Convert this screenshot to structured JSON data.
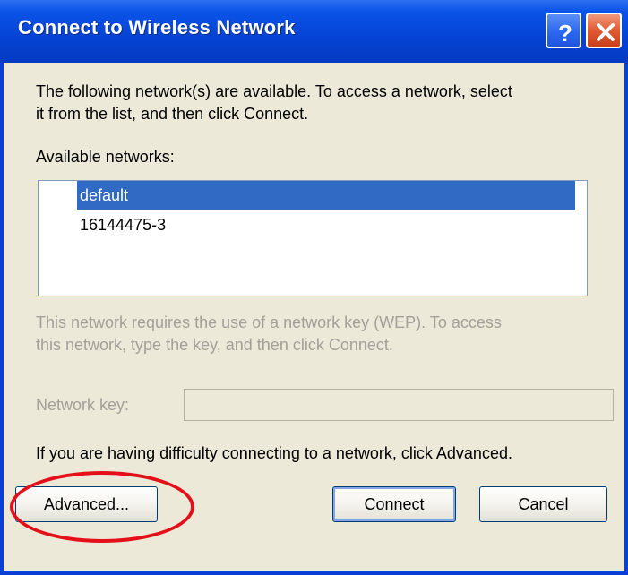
{
  "window": {
    "title": "Connect to Wireless Network",
    "help_icon": "question-mark-icon",
    "close_icon": "close-icon"
  },
  "dialog": {
    "intro_text_line1": "The following network(s) are available. To access a network, select",
    "intro_text_line2": "it from the list, and then click Connect.",
    "available_label": "Available networks:",
    "networks": [
      {
        "name": "default",
        "selected": true
      },
      {
        "name": "16144475-3",
        "selected": false
      }
    ],
    "wep_text_line1": "This network requires the use of a network key (WEP). To access",
    "wep_text_line2": "this network, type the key, and then click Connect.",
    "network_key_label": "Network key:",
    "network_key_value": "",
    "help_text": "If you are having difficulty connecting to a network, click Advanced."
  },
  "buttons": {
    "advanced": "Advanced...",
    "connect": "Connect",
    "cancel": "Cancel"
  },
  "annotation": {
    "highlight_color": "#e3101a",
    "highlight_target": "advanced-button"
  },
  "colors": {
    "titlebar": "#0644d6",
    "selection": "#316ac5",
    "dialog_bg": "#ece9d8"
  }
}
